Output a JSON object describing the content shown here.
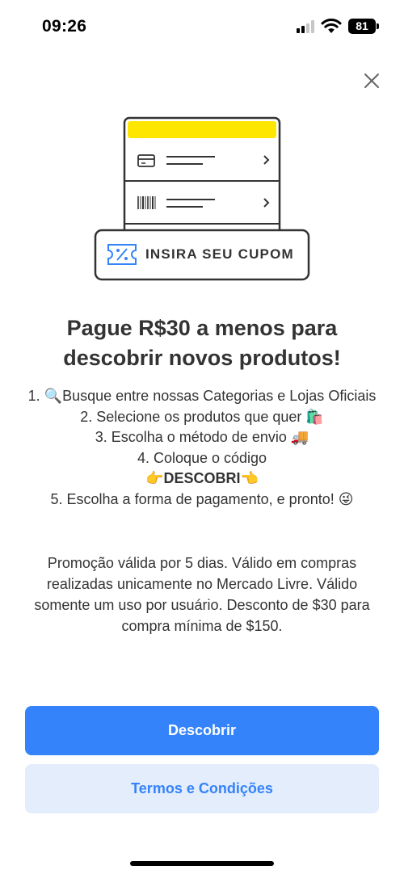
{
  "status_bar": {
    "time": "09:26",
    "battery": "81",
    "icons": [
      "signal-icon",
      "wifi-icon",
      "battery-icon"
    ]
  },
  "close_icon": "close-icon",
  "illustration": {
    "accent_color": "#ffe600",
    "coupon_label": "INSIRA SEU CUPOM",
    "icons": [
      "card-icon",
      "barcode-icon",
      "chevron-right-icon",
      "coupon-icon"
    ]
  },
  "headline": "Pague R$30 a menos para descobrir novos produtos!",
  "steps": {
    "step1_prefix": "1. ",
    "step1_icon": "🔍",
    "step1_text": "Busque entre nossas Categorias e Lojas Oficiais",
    "step2_text": "2. Selecione os produtos que quer ",
    "step2_icon": "🛍️",
    "step3_text": "3. Escolha o método de envio ",
    "step3_icon": "🚚",
    "step4_text": "4. Coloque o código",
    "code_left_icon": "👉",
    "code": "DESCOBRI",
    "code_right_icon": "👈",
    "step5_text": "5. Escolha a forma de pagamento, e pronto! ",
    "step5_icon": "😜"
  },
  "promo_text": "Promoção válida por 5 dias. Válido em compras realizadas unicamente no Mercado Livre. Válido somente um uso por usuário. Desconto de $30 para compra mínima de $150.",
  "buttons": {
    "primary_label": "Descobrir",
    "secondary_label": "Termos e Condições"
  },
  "colors": {
    "primary": "#3483fa",
    "secondary_bg": "#e3edfb",
    "text": "#333333",
    "brand_yellow": "#ffe600",
    "coupon_icon_blue": "#3483fa"
  }
}
